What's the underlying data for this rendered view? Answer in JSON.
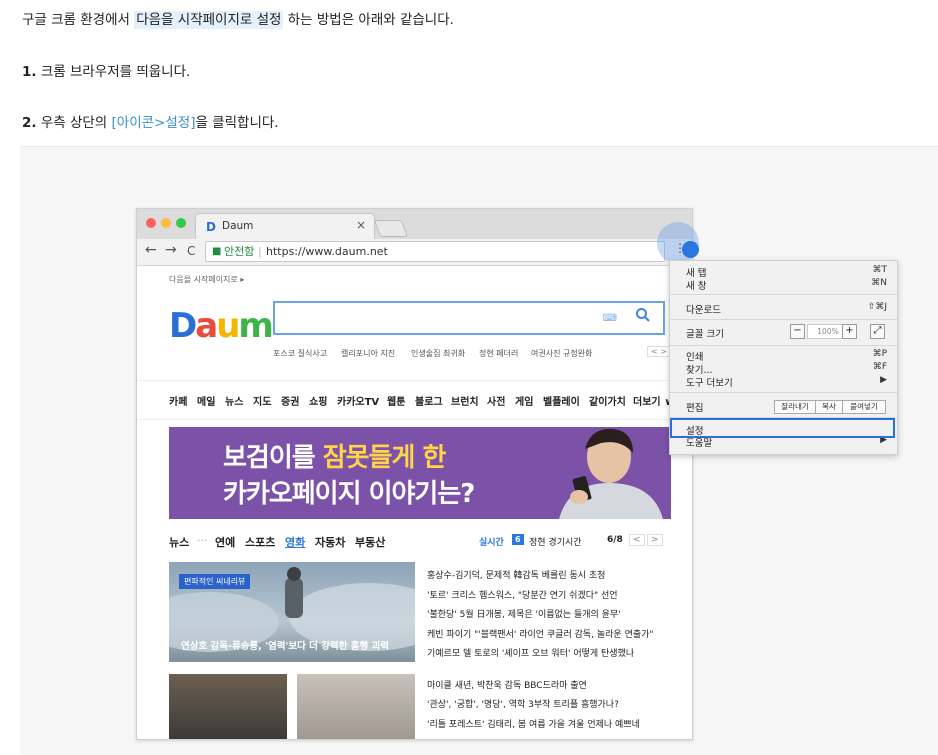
{
  "article": {
    "intro_before": "구글 크롬 환경에서 ",
    "intro_highlight": "다음을 시작페이지로 설정",
    "intro_after": " 하는 방법은 아래와 같습니다.",
    "step1_num": "1.",
    "step1_text": " 크롬 브라우저를 띄웁니다.",
    "step2_num": "2.",
    "step2_before": " 우측 상단의 ",
    "step2_link": "[아이콘>설정]",
    "step2_after": "을 클릭합니다."
  },
  "browser": {
    "tab_logo": "D",
    "tab_title": "Daum",
    "tab_close": "×",
    "back": "←",
    "forward": "→",
    "reload": "C",
    "lock": "🔒",
    "secure_label": "안전함",
    "url": "https://www.daum.net",
    "kebab": "⋮"
  },
  "daum": {
    "set_start_page": "다음을 시작페이지로 ▸",
    "logo": "Daum",
    "keyboard_icon": "⌨",
    "search_icon": "⚲",
    "suggestions": [
      "포스코 질식사고",
      "캘리포니아 지진",
      "인생술집 최귀화",
      "정현 페더러",
      "여권사진 규정완화"
    ],
    "suggest_arrows": "< >",
    "menu": [
      "카페",
      "메일",
      "뉴스",
      "지도",
      "증권",
      "쇼핑",
      "카카오TV",
      "웹툰",
      "블로그",
      "브런치",
      "사전",
      "게임",
      "벨플레이",
      "같이가치",
      "더보기 ∨"
    ],
    "banner_line1_before": "보검이를 ",
    "banner_line1_em": "잠못들게 한",
    "banner_line2": "카카오페이지 이야기는?",
    "news_tabs": [
      "뉴스",
      "···",
      "연예",
      "스포츠",
      "영화",
      "자동차",
      "부동산"
    ],
    "realtime": "실시간",
    "realtime_rank": "6",
    "realtime_item": "정현 경기시간",
    "page_counter": "6/8",
    "page_prev": "<",
    "page_next": ">",
    "photo_tag": "편파적인 씨네리뷰",
    "photo_caption": "연상호 감독-류승룡, '염력'보다 더 강력한 흥행 괴력",
    "headlines": [
      "홍상수-김기덕, 문제적 韓감독 베를린 동시 초청",
      "'토르' 크리스 헴스워스, \"당분간 연기 쉬겠다\" 선언",
      "'불한당' 5월 日개봉, 제목은 '이름없는 들개의 윤무'",
      "케빈 파이기 \"'블랙팬서' 라이언 쿠글러 감독, 놀라운 연출가\"",
      "기예르모 델 토로의 '셰이프 오브 워터' 어떻게 탄생했나"
    ],
    "headlines2": [
      "마이클 새년, 박찬욱 감독 BBC드라마 출연",
      "'관상', '궁합', '명당', 역학 3부작 트리플 흥행가나?",
      "'리틀 포레스트' 김태리, 봄 여름 가을 겨울 언제나 예쁘네"
    ]
  },
  "chrome_menu": {
    "new_tab": "새 탭",
    "new_tab_sc": "⌘T",
    "new_window": "새 창",
    "new_window_sc": "⌘N",
    "downloads": "다운로드",
    "downloads_sc": "⇧⌘J",
    "font_size": "글꼴 크기",
    "zoom_minus": "−",
    "zoom_value": "100%",
    "zoom_plus": "+",
    "fullscreen": "⤢",
    "print": "인쇄",
    "print_sc": "⌘P",
    "find": "찾기...",
    "find_sc": "⌘F",
    "more_tools": "도구 더보기",
    "more_tools_arrow": "▶",
    "edit": "편집",
    "cut": "잘라내기",
    "copy": "복사",
    "paste": "붙여넣기",
    "settings": "설정",
    "help": "도움말",
    "help_arrow": "▶"
  },
  "colors": {
    "accent": "#2a77e0",
    "link": "#3a8fd0",
    "banner": "#7b52a8",
    "highlight": "#e4f0fb"
  }
}
